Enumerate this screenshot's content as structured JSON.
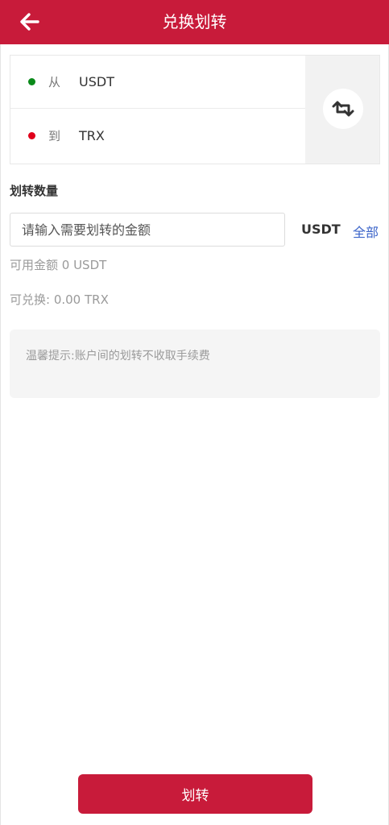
{
  "header": {
    "title": "兑换划转",
    "back_icon": "arrow-left-icon"
  },
  "swap": {
    "from": {
      "label": "从",
      "coin": "USDT",
      "dot_color": "#0a8a1a"
    },
    "to": {
      "label": "到",
      "coin": "TRX",
      "dot_color": "#e0001b"
    },
    "toggle_icon": "swap-arrows-icon"
  },
  "amount": {
    "section_title": "划转数量",
    "placeholder": "请输入需要划转的金额",
    "value": "",
    "unit": "USDT",
    "all_label": "全部"
  },
  "info": {
    "available": "可用金额 0 USDT",
    "exchangeable": "可兑换: 0.00 TRX"
  },
  "tip": {
    "text": "温馨提示:账户间的划转不收取手续费"
  },
  "submit": {
    "label": "划转"
  },
  "colors": {
    "brand": "#c81b3a",
    "link": "#3b64c9"
  }
}
